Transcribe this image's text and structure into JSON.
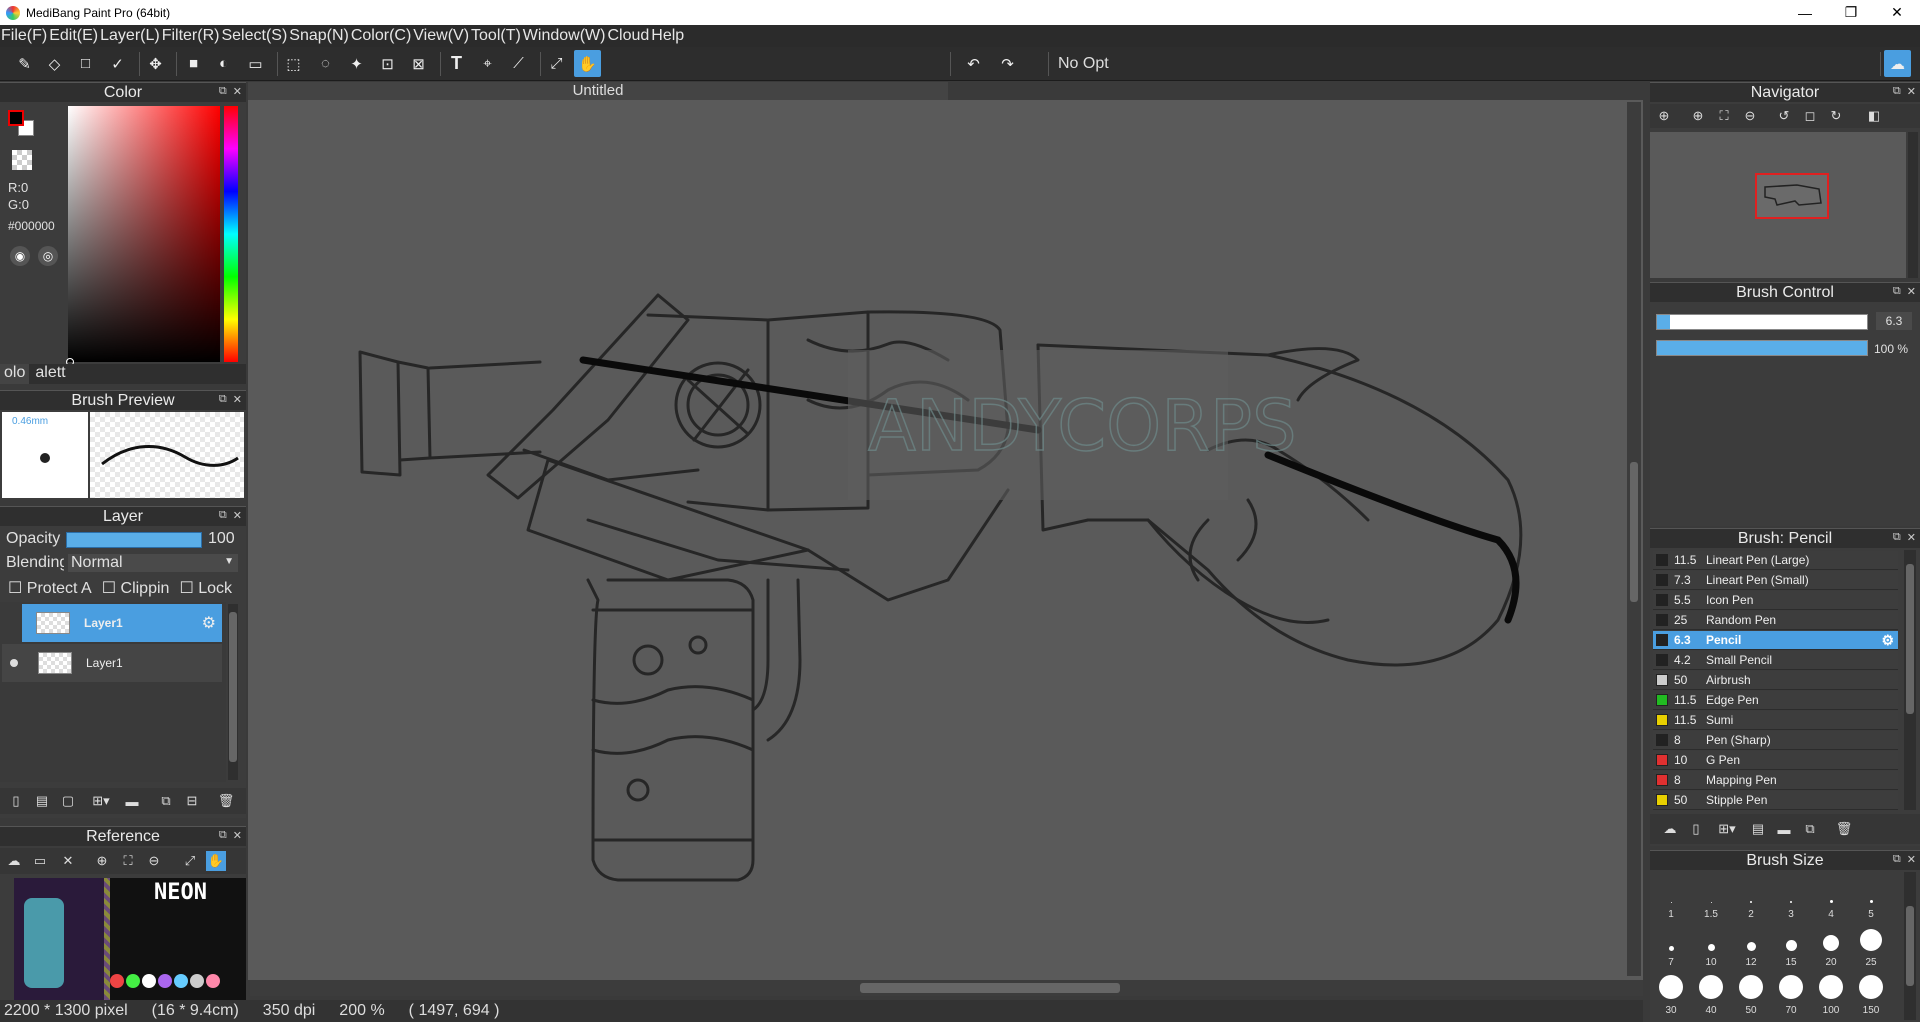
{
  "window": {
    "title": "MediBang Paint Pro (64bit)",
    "min": "—",
    "max": "❐",
    "close": "✕"
  },
  "menu": [
    "File(F)",
    "Edit(E)",
    "Layer(L)",
    "Filter(R)",
    "Select(S)",
    "Snap(N)",
    "Color(C)",
    "View(V)",
    "Tool(T)",
    "Window(W)",
    "Cloud",
    "Help"
  ],
  "toolbar": {
    "option_text": "No Opt"
  },
  "color_panel": {
    "title": "Color",
    "r": "R:0",
    "g": "G:0",
    "hex": "#000000",
    "tab1": "olo",
    "tab2": "alett"
  },
  "brush_preview": {
    "title": "Brush Preview",
    "size": "0.46mm"
  },
  "layer_panel": {
    "title": "Layer",
    "opacity_label": "Opacity",
    "opacity_value": "100",
    "blending_label": "Blending",
    "blending_value": "Normal",
    "protect": "Protect A",
    "clipping": "Clippin",
    "lock": "Lock",
    "layers": [
      {
        "name": "Layer1",
        "selected": true
      },
      {
        "name": "Layer1",
        "selected": false
      }
    ]
  },
  "reference": {
    "title": "Reference",
    "image_title": "NEON"
  },
  "document": {
    "tab": "Untitled"
  },
  "status": {
    "pixels": "2200 * 1300 pixel",
    "cm": "(16 * 9.4cm)",
    "dpi": "350 dpi",
    "zoom": "200 %",
    "coords": "( 1497, 694 )"
  },
  "navigator": {
    "title": "Navigator"
  },
  "brush_control": {
    "title": "Brush Control",
    "size_value": "6.3",
    "size_fraction": 0.06,
    "opacity_value": "100 %",
    "opacity_fraction": 1.0
  },
  "brush_list": {
    "title": "Brush: Pencil",
    "items": [
      {
        "size": "11.5",
        "name": "Lineart Pen (Large)",
        "color": "#222222"
      },
      {
        "size": "7.3",
        "name": "Lineart Pen (Small)",
        "color": "#222222"
      },
      {
        "size": "5.5",
        "name": "Icon Pen",
        "color": "#222222"
      },
      {
        "size": "25",
        "name": "Random Pen",
        "color": "#222222"
      },
      {
        "size": "6.3",
        "name": "Pencil",
        "color": "#222222",
        "selected": true
      },
      {
        "size": "4.2",
        "name": "Small Pencil",
        "color": "#222222"
      },
      {
        "size": "50",
        "name": "Airbrush",
        "color": "#cccccc"
      },
      {
        "size": "11.5",
        "name": "Edge Pen",
        "color": "#22bb22"
      },
      {
        "size": "11.5",
        "name": "Sumi",
        "color": "#e8d000"
      },
      {
        "size": "8",
        "name": "Pen (Sharp)",
        "color": "#222222"
      },
      {
        "size": "10",
        "name": "G Pen",
        "color": "#e03030"
      },
      {
        "size": "8",
        "name": "Mapping Pen",
        "color": "#e03030"
      },
      {
        "size": "50",
        "name": "Stipple Pen",
        "color": "#e8d000"
      }
    ]
  },
  "brush_size": {
    "title": "Brush Size",
    "sizes": [
      "1",
      "1.5",
      "2",
      "3",
      "4",
      "5",
      "7",
      "10",
      "12",
      "15",
      "20",
      "25",
      "30",
      "40",
      "50",
      "70",
      "100",
      "150"
    ]
  },
  "colors": {
    "accent": "#4a9ee0",
    "canvas": "#5a5a5a"
  }
}
